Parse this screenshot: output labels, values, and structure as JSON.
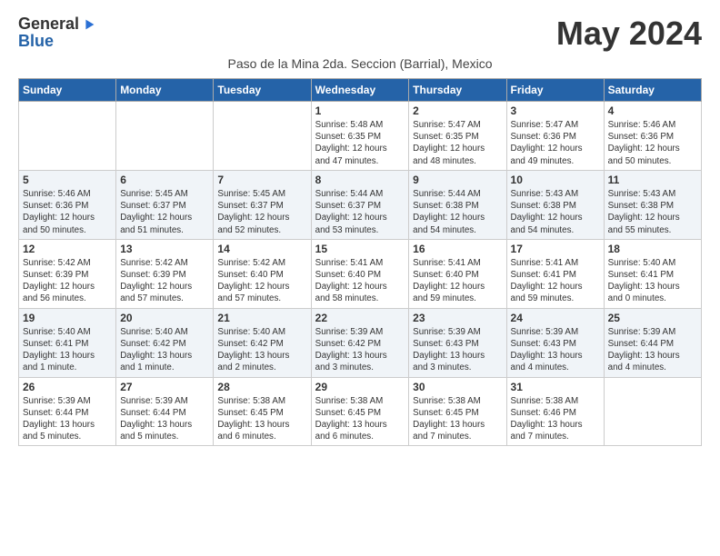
{
  "logo": {
    "general": "General",
    "blue": "Blue",
    "arrow": "▶"
  },
  "title": "May 2024",
  "subtitle": "Paso de la Mina 2da. Seccion (Barrial), Mexico",
  "days_of_week": [
    "Sunday",
    "Monday",
    "Tuesday",
    "Wednesday",
    "Thursday",
    "Friday",
    "Saturday"
  ],
  "weeks": [
    {
      "stripe": false,
      "days": [
        {
          "num": "",
          "info": ""
        },
        {
          "num": "",
          "info": ""
        },
        {
          "num": "",
          "info": ""
        },
        {
          "num": "1",
          "info": "Sunrise: 5:48 AM\nSunset: 6:35 PM\nDaylight: 12 hours\nand 47 minutes."
        },
        {
          "num": "2",
          "info": "Sunrise: 5:47 AM\nSunset: 6:35 PM\nDaylight: 12 hours\nand 48 minutes."
        },
        {
          "num": "3",
          "info": "Sunrise: 5:47 AM\nSunset: 6:36 PM\nDaylight: 12 hours\nand 49 minutes."
        },
        {
          "num": "4",
          "info": "Sunrise: 5:46 AM\nSunset: 6:36 PM\nDaylight: 12 hours\nand 50 minutes."
        }
      ]
    },
    {
      "stripe": true,
      "days": [
        {
          "num": "5",
          "info": "Sunrise: 5:46 AM\nSunset: 6:36 PM\nDaylight: 12 hours\nand 50 minutes."
        },
        {
          "num": "6",
          "info": "Sunrise: 5:45 AM\nSunset: 6:37 PM\nDaylight: 12 hours\nand 51 minutes."
        },
        {
          "num": "7",
          "info": "Sunrise: 5:45 AM\nSunset: 6:37 PM\nDaylight: 12 hours\nand 52 minutes."
        },
        {
          "num": "8",
          "info": "Sunrise: 5:44 AM\nSunset: 6:37 PM\nDaylight: 12 hours\nand 53 minutes."
        },
        {
          "num": "9",
          "info": "Sunrise: 5:44 AM\nSunset: 6:38 PM\nDaylight: 12 hours\nand 54 minutes."
        },
        {
          "num": "10",
          "info": "Sunrise: 5:43 AM\nSunset: 6:38 PM\nDaylight: 12 hours\nand 54 minutes."
        },
        {
          "num": "11",
          "info": "Sunrise: 5:43 AM\nSunset: 6:38 PM\nDaylight: 12 hours\nand 55 minutes."
        }
      ]
    },
    {
      "stripe": false,
      "days": [
        {
          "num": "12",
          "info": "Sunrise: 5:42 AM\nSunset: 6:39 PM\nDaylight: 12 hours\nand 56 minutes."
        },
        {
          "num": "13",
          "info": "Sunrise: 5:42 AM\nSunset: 6:39 PM\nDaylight: 12 hours\nand 57 minutes."
        },
        {
          "num": "14",
          "info": "Sunrise: 5:42 AM\nSunset: 6:40 PM\nDaylight: 12 hours\nand 57 minutes."
        },
        {
          "num": "15",
          "info": "Sunrise: 5:41 AM\nSunset: 6:40 PM\nDaylight: 12 hours\nand 58 minutes."
        },
        {
          "num": "16",
          "info": "Sunrise: 5:41 AM\nSunset: 6:40 PM\nDaylight: 12 hours\nand 59 minutes."
        },
        {
          "num": "17",
          "info": "Sunrise: 5:41 AM\nSunset: 6:41 PM\nDaylight: 12 hours\nand 59 minutes."
        },
        {
          "num": "18",
          "info": "Sunrise: 5:40 AM\nSunset: 6:41 PM\nDaylight: 13 hours\nand 0 minutes."
        }
      ]
    },
    {
      "stripe": true,
      "days": [
        {
          "num": "19",
          "info": "Sunrise: 5:40 AM\nSunset: 6:41 PM\nDaylight: 13 hours\nand 1 minute."
        },
        {
          "num": "20",
          "info": "Sunrise: 5:40 AM\nSunset: 6:42 PM\nDaylight: 13 hours\nand 1 minute."
        },
        {
          "num": "21",
          "info": "Sunrise: 5:40 AM\nSunset: 6:42 PM\nDaylight: 13 hours\nand 2 minutes."
        },
        {
          "num": "22",
          "info": "Sunrise: 5:39 AM\nSunset: 6:42 PM\nDaylight: 13 hours\nand 3 minutes."
        },
        {
          "num": "23",
          "info": "Sunrise: 5:39 AM\nSunset: 6:43 PM\nDaylight: 13 hours\nand 3 minutes."
        },
        {
          "num": "24",
          "info": "Sunrise: 5:39 AM\nSunset: 6:43 PM\nDaylight: 13 hours\nand 4 minutes."
        },
        {
          "num": "25",
          "info": "Sunrise: 5:39 AM\nSunset: 6:44 PM\nDaylight: 13 hours\nand 4 minutes."
        }
      ]
    },
    {
      "stripe": false,
      "days": [
        {
          "num": "26",
          "info": "Sunrise: 5:39 AM\nSunset: 6:44 PM\nDaylight: 13 hours\nand 5 minutes."
        },
        {
          "num": "27",
          "info": "Sunrise: 5:39 AM\nSunset: 6:44 PM\nDaylight: 13 hours\nand 5 minutes."
        },
        {
          "num": "28",
          "info": "Sunrise: 5:38 AM\nSunset: 6:45 PM\nDaylight: 13 hours\nand 6 minutes."
        },
        {
          "num": "29",
          "info": "Sunrise: 5:38 AM\nSunset: 6:45 PM\nDaylight: 13 hours\nand 6 minutes."
        },
        {
          "num": "30",
          "info": "Sunrise: 5:38 AM\nSunset: 6:45 PM\nDaylight: 13 hours\nand 7 minutes."
        },
        {
          "num": "31",
          "info": "Sunrise: 5:38 AM\nSunset: 6:46 PM\nDaylight: 13 hours\nand 7 minutes."
        },
        {
          "num": "",
          "info": ""
        }
      ]
    }
  ]
}
